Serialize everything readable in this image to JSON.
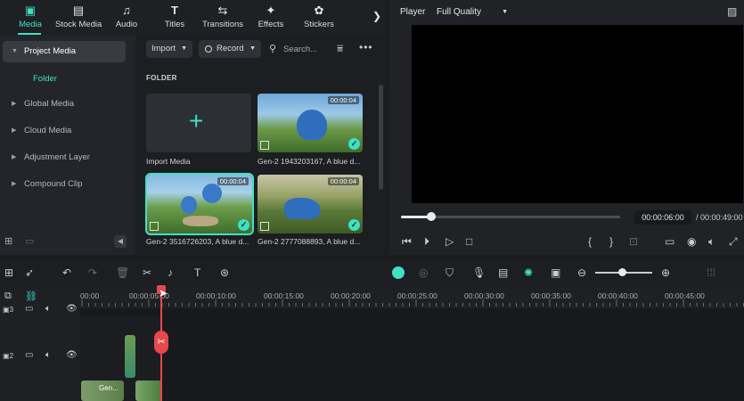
{
  "toolbar": {
    "items": [
      {
        "label": "Media",
        "icon": "media-icon",
        "active": true
      },
      {
        "label": "Stock Media",
        "icon": "stock-media-icon"
      },
      {
        "label": "Audio",
        "icon": "audio-icon"
      },
      {
        "label": "Titles",
        "icon": "titles-icon"
      },
      {
        "label": "Transitions",
        "icon": "transitions-icon"
      },
      {
        "label": "Effects",
        "icon": "effects-icon"
      },
      {
        "label": "Stickers",
        "icon": "stickers-icon"
      }
    ],
    "more_arrow": "❯"
  },
  "sidebar": {
    "project_media": "Project Media",
    "folder": "Folder",
    "items": [
      "Global Media",
      "Cloud Media",
      "Adjustment Layer",
      "Compound Clip"
    ]
  },
  "media_toolbar": {
    "import_label": "Import",
    "record_label": "Record",
    "search_placeholder": "Search..."
  },
  "media": {
    "folder_heading": "FOLDER",
    "import_caption": "Import Media",
    "clips": [
      {
        "caption": "Gen-2 1943203167, A blue d...",
        "duration": "00:00:04",
        "selected": false
      },
      {
        "caption": "Gen-2 3516726203, A blue d...",
        "duration": "00:00:04",
        "selected": true
      },
      {
        "caption": "Gen-2 2777088893, A blue d...",
        "duration": "00:00:04",
        "selected": false
      }
    ]
  },
  "player": {
    "label": "Player",
    "quality": "Full Quality",
    "current_time": "00:00:06:00",
    "total_time": "/ 00:00:49:00",
    "progress": 0.14
  },
  "timeline": {
    "ticks": [
      "00:00",
      "00:00:05:00",
      "00:00:10:00",
      "00:00:15:00",
      "00:00:20:00",
      "00:00:25:00",
      "00:00:30:00",
      "00:00:35:00",
      "00:00:40:00",
      "00:00:45:00"
    ],
    "track3": "3",
    "track2": "2",
    "clip_label": "Gen..."
  },
  "colors": {
    "accent": "#3fe0c5",
    "playhead": "#e5484d"
  }
}
